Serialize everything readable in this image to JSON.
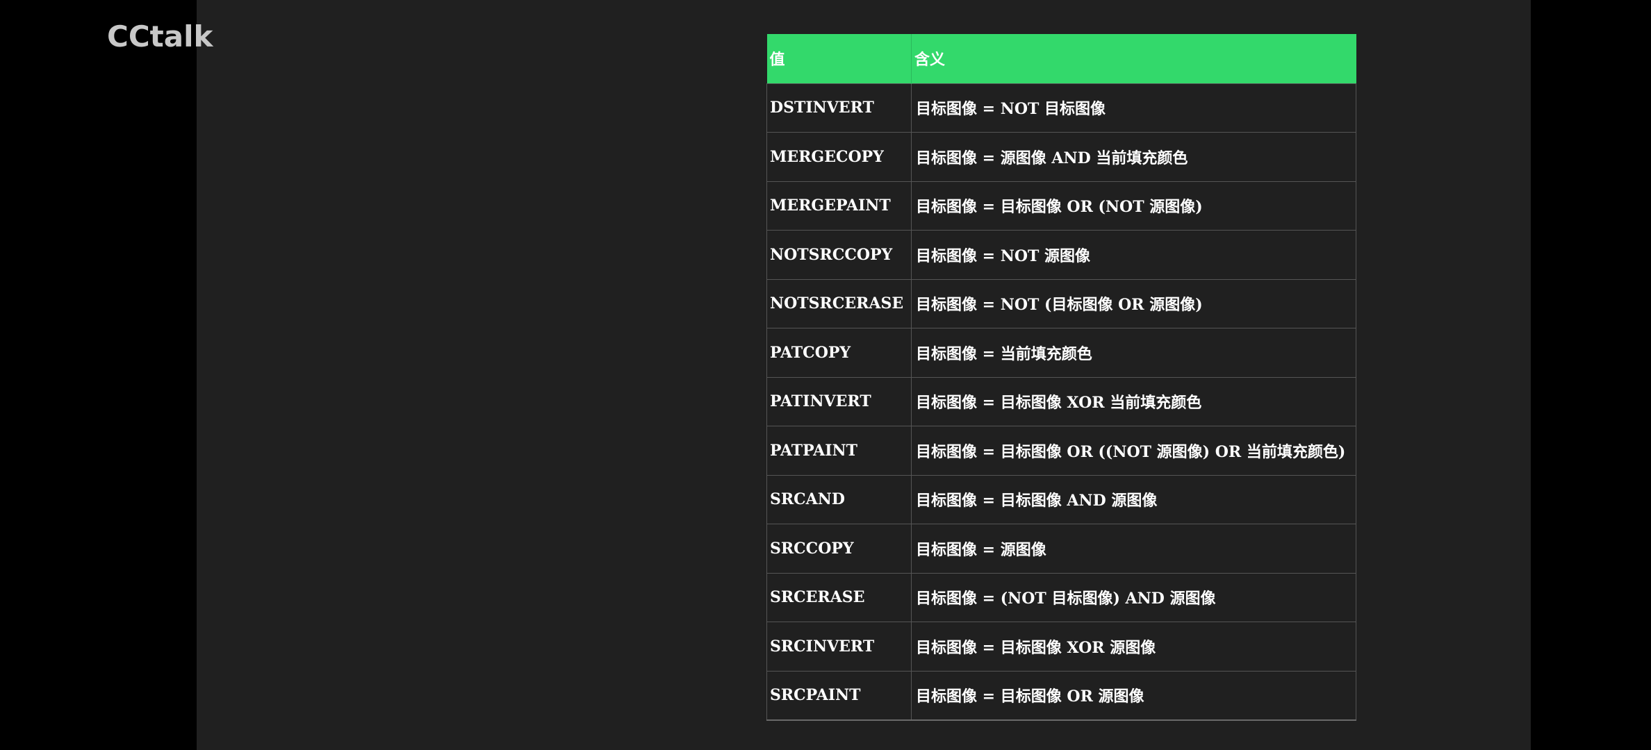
{
  "watermark": "CCtalk",
  "table": {
    "headers": [
      "值",
      "含义"
    ],
    "rows": [
      {
        "value": "DSTINVERT",
        "meaning": "目标图像 = NOT 目标图像"
      },
      {
        "value": "MERGECOPY",
        "meaning": "目标图像 = 源图像 AND 当前填充颜色"
      },
      {
        "value": "MERGEPAINT",
        "meaning": "目标图像 = 目标图像 OR (NOT 源图像)"
      },
      {
        "value": "NOTSRCCOPY",
        "meaning": "目标图像 = NOT 源图像"
      },
      {
        "value": "NOTSRCERASE",
        "meaning": "目标图像 = NOT (目标图像 OR 源图像)"
      },
      {
        "value": "PATCOPY",
        "meaning": "目标图像 = 当前填充颜色"
      },
      {
        "value": "PATINVERT",
        "meaning": "目标图像 = 目标图像 XOR 当前填充颜色"
      },
      {
        "value": "PATPAINT",
        "meaning": "目标图像 = 目标图像 OR ((NOT 源图像) OR 当前填充颜色)"
      },
      {
        "value": "SRCAND",
        "meaning": "目标图像 = 目标图像 AND 源图像"
      },
      {
        "value": "SRCCOPY",
        "meaning": "目标图像 = 源图像"
      },
      {
        "value": "SRCERASE",
        "meaning": "目标图像 = (NOT 目标图像) AND 源图像"
      },
      {
        "value": "SRCINVERT",
        "meaning": "目标图像 = 目标图像 XOR 源图像"
      },
      {
        "value": "SRCPAINT",
        "meaning": "目标图像 = 目标图像 OR 源图像"
      }
    ]
  },
  "colors": {
    "header_bg": "#33d96b",
    "stage_bg": "#202020",
    "outer_bg": "#000000",
    "text": "#ffffff",
    "watermark": "#c8c8c8"
  }
}
